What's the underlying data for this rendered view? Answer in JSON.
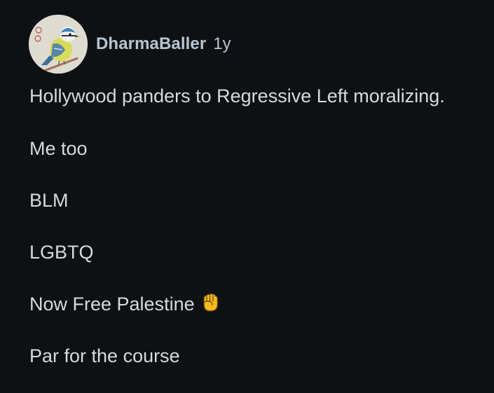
{
  "comment": {
    "author": "DharmaBaller",
    "age": "1y",
    "avatar_icon": "blue-tit-bird-icon",
    "lines": [
      "Hollywood panders to Regressive Left moralizing.",
      "Me too",
      "BLM",
      "LGBTQ",
      "Now Free Palestine",
      "Par for the course"
    ],
    "emoji": "raised-fist-icon"
  },
  "colors": {
    "background": "#0e1114",
    "text": "#d7dadc",
    "meta": "#b8c5cf",
    "fist": "#f6b91e"
  }
}
